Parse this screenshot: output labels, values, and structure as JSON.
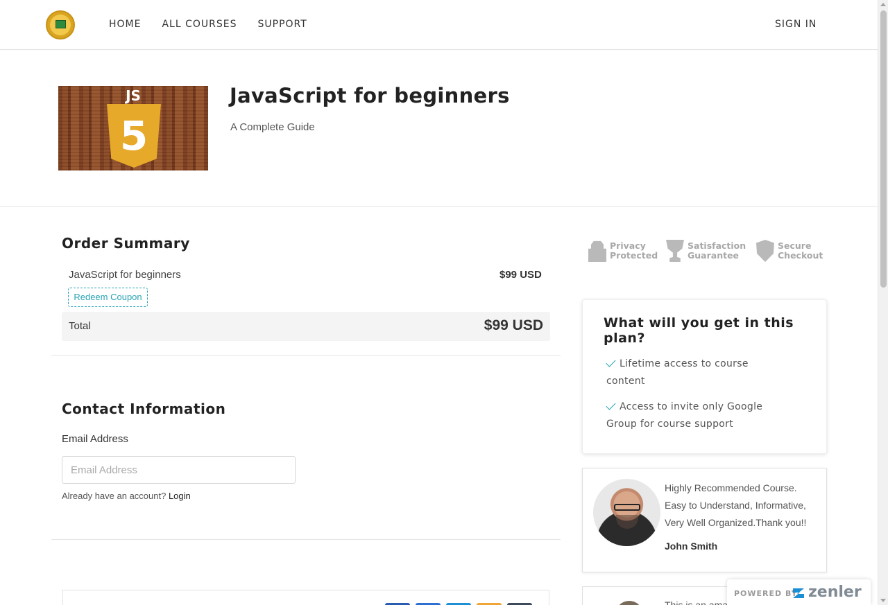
{
  "header": {
    "nav": [
      "HOME",
      "ALL COURSES",
      "SUPPORT"
    ],
    "signin": "SIGN IN"
  },
  "course": {
    "title": "JavaScript for beginners",
    "subtitle": "A Complete Guide",
    "image_badge": "JS",
    "image_glyph": "5"
  },
  "order": {
    "heading": "Order Summary",
    "item_name": "JavaScript for beginners",
    "item_price": "$99 USD",
    "coupon_label": "Redeem Coupon",
    "total_label": "Total",
    "total_value": "$99 USD"
  },
  "contact": {
    "heading": "Contact Information",
    "email_label": "Email Address",
    "email_placeholder": "Email Address",
    "email_value": "",
    "account_prompt": "Already have an account?",
    "login_label": "Login"
  },
  "trust": [
    {
      "line1": "Privacy",
      "line2": "Protected",
      "icon": "lock-icon"
    },
    {
      "line1": "Satisfaction",
      "line2": "Guarantee",
      "icon": "trophy-icon"
    },
    {
      "line1": "Secure",
      "line2": "Checkout",
      "icon": "shield-check-icon"
    }
  ],
  "plan": {
    "heading": "What will you get in this plan?",
    "items": [
      "Lifetime access to course content",
      "Access to invite only Google Group for course support"
    ]
  },
  "reviews": [
    {
      "text": "Highly Recommended Course. Easy to Understand, Informative, Very Well Organized.Thank you!!",
      "name": "John Smith"
    },
    {
      "text": "This is an ama"
    }
  ],
  "payment_colors": [
    "#2a5db0",
    "#2f6fd1",
    "#1f8fd6",
    "#f0a53a",
    "#3c4a5a"
  ],
  "powered": {
    "label": "POWERED BY",
    "brand": "zenler"
  },
  "colors": {
    "accent": "#27a3b5",
    "brand_z": "#1a8fd6"
  }
}
